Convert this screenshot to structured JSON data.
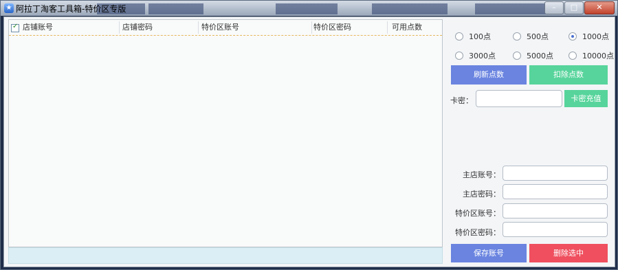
{
  "window": {
    "title": "阿拉丁淘客工具箱-特价区专版"
  },
  "grid": {
    "columns": [
      "店铺账号",
      "店铺密码",
      "特价区账号",
      "特价区密码",
      "可用点数"
    ]
  },
  "points": {
    "options": [
      "100点",
      "500点",
      "1000点",
      "3000点",
      "5000点",
      "10000点"
    ],
    "selected": "1000点"
  },
  "actions": {
    "refresh_points": "刷新点数",
    "deduct_points": "扣除点数",
    "card_recharge": "卡密充值",
    "save_account": "保存账号",
    "delete_selected": "删除选中"
  },
  "form": {
    "card_label": "卡密：",
    "main_account_label": "主店账号：",
    "main_password_label": "主店密码：",
    "special_account_label": "特价区账号：",
    "special_password_label": "特价区密码："
  }
}
